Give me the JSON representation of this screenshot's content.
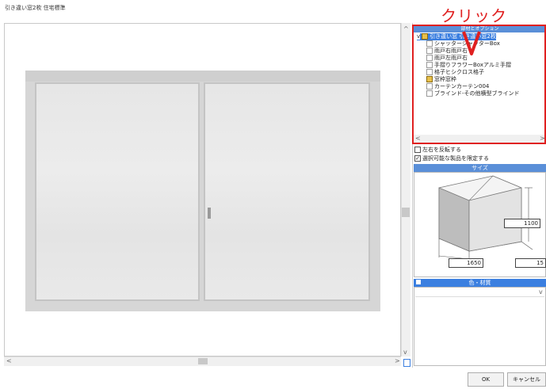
{
  "window": {
    "title": "引き違い窓2枚 住宅標準"
  },
  "annotation": {
    "click_label": "クリック",
    "color": "#e02020"
  },
  "tree": {
    "header": "部材とオプション",
    "items": [
      {
        "label": "引き違い窓 引き違い窓2枚",
        "level": 0,
        "selected": true,
        "expander": "v",
        "folder": true
      },
      {
        "label": "シャッターシャッターBox",
        "level": 1
      },
      {
        "label": "雨戸右雨戸右",
        "level": 1
      },
      {
        "label": "雨戸左雨戸右",
        "level": 1
      },
      {
        "label": "手摺りフラワーBoxアルミ手摺",
        "level": 1
      },
      {
        "label": "格子ヒシクロス格子",
        "level": 1
      },
      {
        "label": "窓枠窓枠",
        "level": 1,
        "folder": true
      },
      {
        "label": "カーテンカーテン004",
        "level": 1
      },
      {
        "label": "ブラインド-その他横型ブラインド",
        "level": 1
      }
    ]
  },
  "options": {
    "flip": {
      "label": "左右を反転する",
      "checked": false
    },
    "limit": {
      "label": "選択可能な製品を限定する",
      "checked": true
    }
  },
  "size": {
    "header": "サイズ",
    "height_value": "1100",
    "width_value": "1650",
    "depth_value": "15"
  },
  "color": {
    "header": "色・材質"
  },
  "buttons": {
    "ok": "OK",
    "cancel": "キャンセル"
  },
  "scroll": {
    "left": "<",
    "right": ">",
    "up": "^",
    "down": "v",
    "tree_left": "<",
    "tree_right": ">"
  }
}
